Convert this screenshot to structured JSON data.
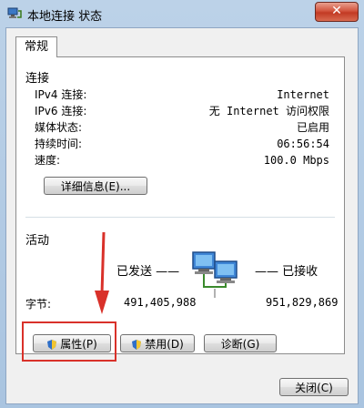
{
  "window": {
    "title": "本地连接 状态",
    "close_symbol": "✕"
  },
  "tabs": [
    {
      "label": "常规"
    }
  ],
  "connection": {
    "title": "连接",
    "rows": [
      {
        "label": "IPv4 连接:",
        "value": "Internet"
      },
      {
        "label": "IPv6 连接:",
        "value": "无 Internet 访问权限"
      },
      {
        "label": "媒体状态:",
        "value": "已启用"
      },
      {
        "label": "持续时间:",
        "value": "06:56:54"
      },
      {
        "label": "速度:",
        "value": "100.0 Mbps"
      }
    ],
    "details_button": "详细信息(E)..."
  },
  "activity": {
    "title": "活动",
    "sent_label": "已发送 ——",
    "received_label": "—— 已接收",
    "bytes_label": "字节:",
    "bytes_sent": "491,405,988",
    "bytes_received": "951,829,869"
  },
  "buttons": {
    "properties": "属性(P)",
    "disable": "禁用(D)",
    "diagnose": "诊断(G)",
    "close": "关闭(C)"
  },
  "highlight_color": "#d9312a",
  "icons": [
    "network-connection-icon",
    "shield-icon",
    "computers-icon",
    "arrow-down-icon"
  ]
}
